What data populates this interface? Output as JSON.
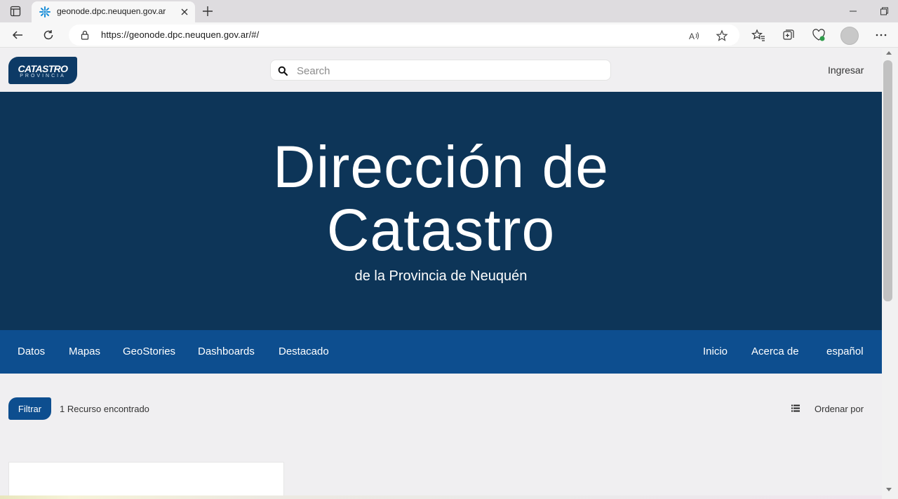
{
  "browser": {
    "tab_title": "geonode.dpc.neuquen.gov.ar",
    "url": "https://geonode.dpc.neuquen.gov.ar/#/",
    "accent_color": "#0078d4"
  },
  "header": {
    "logo_line1": "CATASTRO",
    "logo_line2": "PROVINCIA",
    "search_placeholder": "Search",
    "login_label": "Ingresar"
  },
  "hero": {
    "title_line1": "Dirección de",
    "title_line2": "Catastro",
    "subtitle": "de la Provincia de Neuquén",
    "background_color": "#0d3558"
  },
  "nav": {
    "left_items": [
      "Datos",
      "Mapas",
      "GeoStories",
      "Dashboards",
      "Destacado"
    ],
    "right_items": [
      "Inicio",
      "Acerca de",
      "español"
    ],
    "background_color": "#0d4e8f"
  },
  "results": {
    "filter_label": "Filtrar",
    "count_text": "1 Recurso encontrado",
    "sort_label": "Ordenar por"
  }
}
